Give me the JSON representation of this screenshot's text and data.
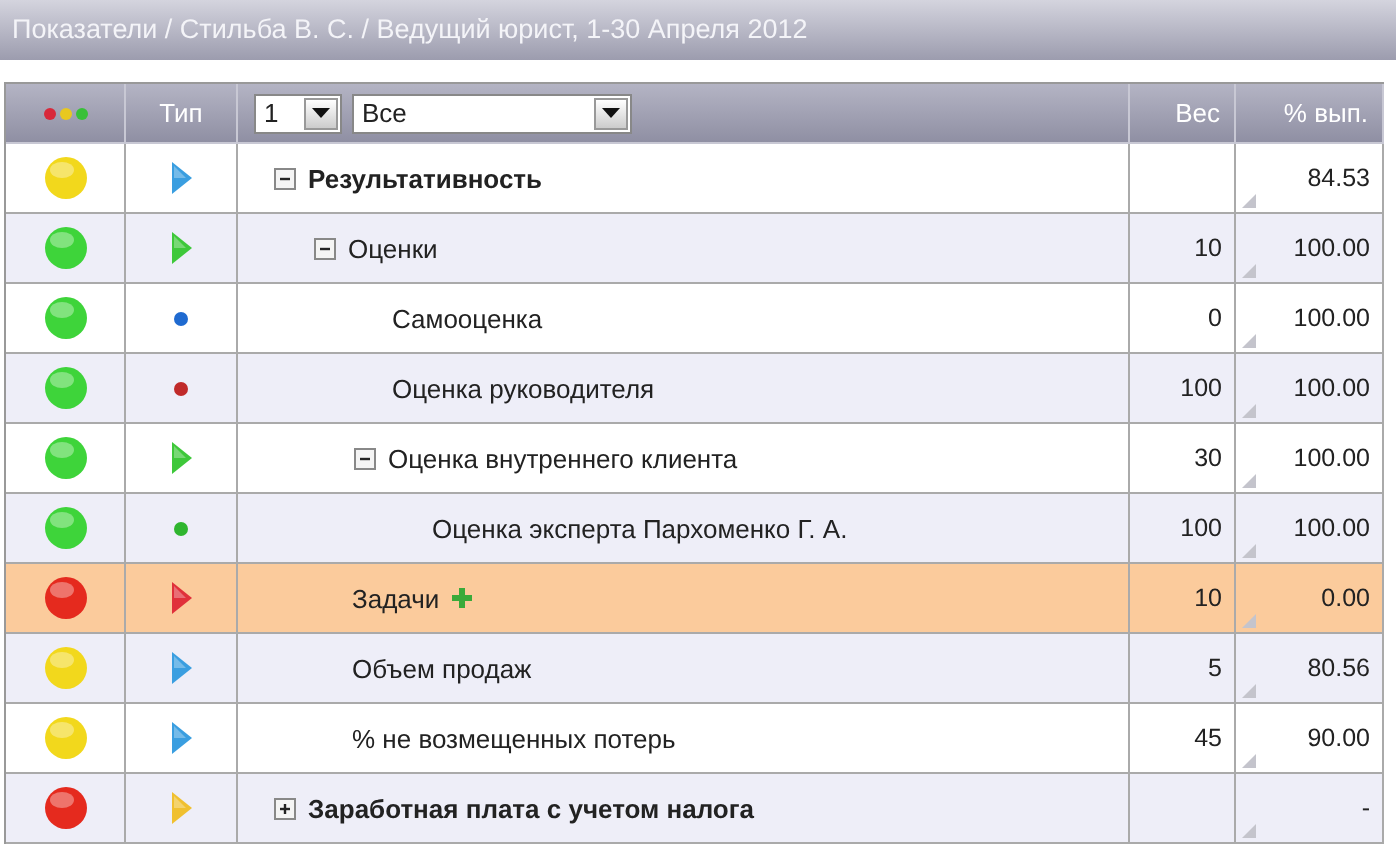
{
  "title": "Показатели / Стильба В. С. / Ведущий юрист, 1-30 Апреля 2012",
  "header": {
    "type_label": "Тип",
    "level_select": {
      "value": "1"
    },
    "filter_select": {
      "value": "Все"
    },
    "weight_label": "Вес",
    "percent_label": "% вып."
  },
  "rows": [
    {
      "name": "Результативность",
      "bold": true,
      "expanded": true,
      "selected": false,
      "status": {
        "color": "#f2d81c"
      },
      "type": {
        "kind": "arrow",
        "color": "#3a9ee0"
      },
      "weight": "",
      "percent": "84.53",
      "children": [
        {
          "name": "Оценки",
          "bold": false,
          "expanded": true,
          "selected": false,
          "status": {
            "color": "#3ed43a"
          },
          "type": {
            "kind": "arrow",
            "color": "#3ec83a"
          },
          "weight": "10",
          "percent": "100.00",
          "children": [
            {
              "name": "Самооценка",
              "bold": false,
              "selected": false,
              "status": {
                "color": "#3ed43a"
              },
              "type": {
                "kind": "dot",
                "color": "#1f6ad0"
              },
              "weight": "0",
              "percent": "100.00"
            },
            {
              "name": "Оценка руководителя",
              "bold": false,
              "selected": false,
              "status": {
                "color": "#3ed43a"
              },
              "type": {
                "kind": "dot",
                "color": "#c02a2a"
              },
              "weight": "100",
              "percent": "100.00"
            },
            {
              "name": "Оценка внутреннего клиента",
              "bold": false,
              "expanded": true,
              "selected": false,
              "status": {
                "color": "#3ed43a"
              },
              "type": {
                "kind": "arrow",
                "color": "#3ec83a"
              },
              "weight": "30",
              "percent": "100.00",
              "children": [
                {
                  "name": "Оценка эксперта Пархоменко Г. А.",
                  "bold": false,
                  "selected": false,
                  "status": {
                    "color": "#3ed43a"
                  },
                  "type": {
                    "kind": "dot",
                    "color": "#2fb52f"
                  },
                  "weight": "100",
                  "percent": "100.00"
                }
              ]
            }
          ]
        },
        {
          "name": "Задачи",
          "bold": false,
          "selected": true,
          "addable": true,
          "status": {
            "color": "#e52a1e"
          },
          "type": {
            "kind": "arrow",
            "color": "#e0303a"
          },
          "weight": "10",
          "percent": "0.00"
        },
        {
          "name": "Объем продаж",
          "bold": false,
          "selected": false,
          "status": {
            "color": "#f2d81c"
          },
          "type": {
            "kind": "arrow",
            "color": "#3a9ee0"
          },
          "weight": "5",
          "percent": "80.56"
        },
        {
          "name": "% не возмещенных потерь",
          "bold": false,
          "selected": false,
          "status": {
            "color": "#f2d81c"
          },
          "type": {
            "kind": "arrow",
            "color": "#3a9ee0"
          },
          "weight": "45",
          "percent": "90.00"
        }
      ]
    },
    {
      "name": "Заработная плата с учетом налога",
      "bold": true,
      "expanded": false,
      "selected": false,
      "status": {
        "color": "#e52a1e"
      },
      "type": {
        "kind": "arrow",
        "color": "#f0c030"
      },
      "weight": "",
      "percent": "-"
    }
  ]
}
